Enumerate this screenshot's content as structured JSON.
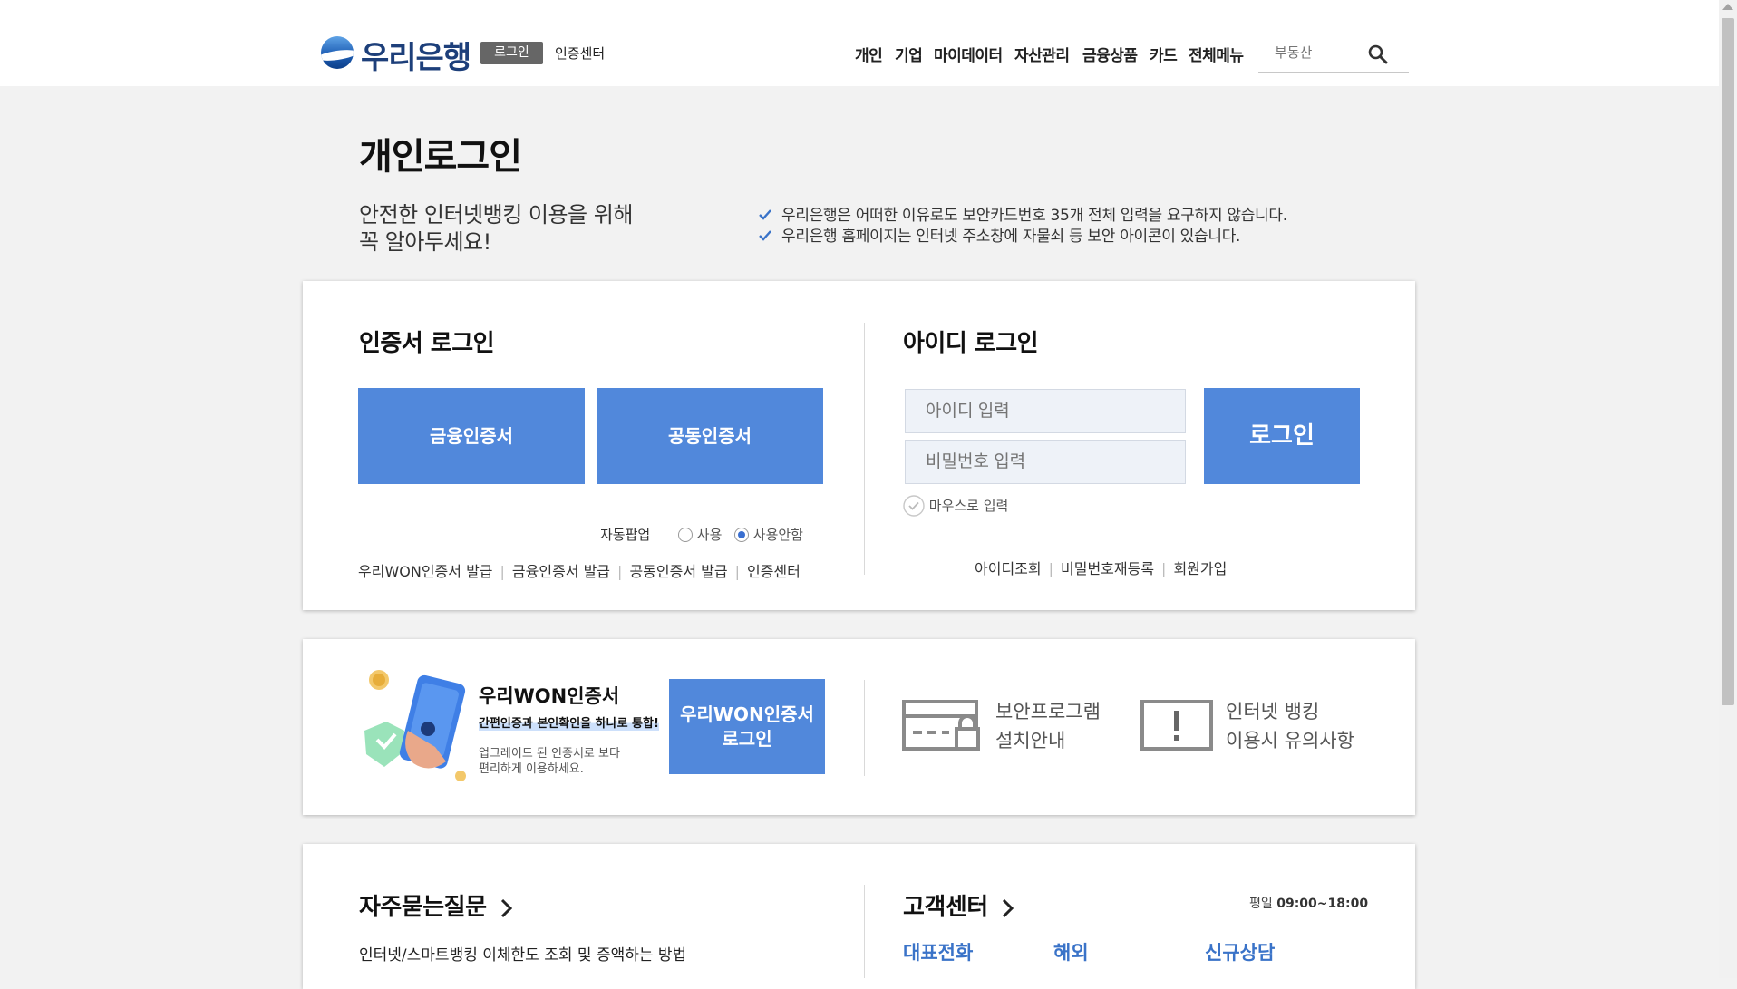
{
  "header": {
    "logo_text": "우리은행",
    "login_badge": "로그인",
    "cert_center": "인증센터",
    "nav": [
      "개인",
      "기업",
      "마이데이터",
      "자산관리",
      "금융상품",
      "카드",
      "전체메뉴"
    ],
    "search_placeholder": "부동산"
  },
  "page": {
    "title": "개인로그인",
    "notice_line1": "안전한 인터넷뱅킹 이용을 위해",
    "notice_line2": "꼭 알아두세요!",
    "notices": [
      "우리은행은 어떠한 이유로도 보안카드번호 35개 전체 입력을 요구하지 않습니다.",
      "우리은행 홈페이지는 인터넷 주소창에 자물쇠 등 보안 아이콘이 있습니다."
    ]
  },
  "cert_login": {
    "title": "인증서 로그인",
    "btn_financial": "금융인증서",
    "btn_joint": "공동인증서",
    "auto_popup_label": "자동팝업",
    "opt_use": "사용",
    "opt_nouse": "사용안함",
    "links": [
      "우리WON인증서 발급",
      "금융인증서 발급",
      "공동인증서 발급",
      "인증센터"
    ]
  },
  "id_login": {
    "title": "아이디 로그인",
    "id_placeholder": "아이디 입력",
    "pw_placeholder": "비밀번호 입력",
    "login_btn": "로그인",
    "mouse_input": "마우스로 입력",
    "links": [
      "아이디조회",
      "비밀번호재등록",
      "회원가입"
    ]
  },
  "won_promo": {
    "title": "우리WON인증서",
    "subtitle": "간편인증과 본인확인을 하나로 통합!",
    "desc_line1": "업그레이드 된 인증서로 보다",
    "desc_line2": "편리하게 이용하세요.",
    "btn_line1": "우리WON인증서",
    "btn_line2": "로그인",
    "security_line1": "보안프로그램",
    "security_line2": "설치안내",
    "caution_line1": "인터넷 뱅킹",
    "caution_line2": "이용시 유의사항"
  },
  "faq": {
    "title": "자주묻는질문",
    "items": [
      "인터넷/스마트뱅킹 이체한도 조회 및 증액하는 방법"
    ]
  },
  "customer_center": {
    "title": "고객센터",
    "hours_label": "평일",
    "hours_value": "09:00~18:00",
    "links": [
      "대표전화",
      "해외",
      "신규상담"
    ]
  },
  "colors": {
    "accent_blue": "#5188db",
    "logo_navy": "#1d3f7a",
    "link_blue": "#3a73c8"
  }
}
